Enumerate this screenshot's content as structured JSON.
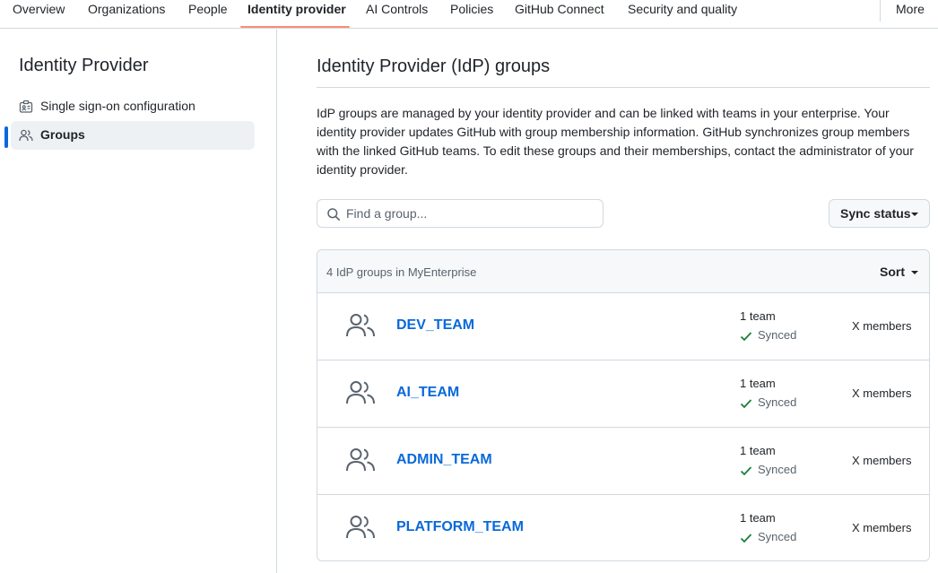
{
  "nav": {
    "tabs": [
      "Overview",
      "Organizations",
      "People",
      "Identity provider",
      "AI Controls",
      "Policies",
      "GitHub Connect",
      "Security and quality"
    ],
    "active_tab": "Identity provider",
    "more_label": "More"
  },
  "sidebar": {
    "title": "Identity Provider",
    "items": [
      {
        "label": "Single sign-on configuration",
        "icon": "id-badge-icon"
      },
      {
        "label": "Groups",
        "icon": "people-icon"
      }
    ],
    "selected": "Groups"
  },
  "main": {
    "title": "Identity Provider (IdP) groups",
    "description": "IdP groups are managed by your identity provider and can be linked with teams in your enterprise. Your identity provider updates GitHub with group membership information. GitHub synchronizes group members with the linked GitHub teams. To edit these groups and their memberships, contact the administrator of your identity provider.",
    "search": {
      "placeholder": "Find a group...",
      "value": ""
    },
    "sync_status_label": "Sync status",
    "list": {
      "count_label": "4 IdP groups in MyEnterprise",
      "sort_label": "Sort",
      "groups": [
        {
          "name": "DEV_TEAM",
          "teams": "1 team",
          "status": "Synced",
          "members": "X members"
        },
        {
          "name": "AI_TEAM",
          "teams": "1 team",
          "status": "Synced",
          "members": "X members"
        },
        {
          "name": "ADMIN_TEAM",
          "teams": "1 team",
          "status": "Synced",
          "members": "X members"
        },
        {
          "name": "PLATFORM_TEAM",
          "teams": "1 team",
          "status": "Synced",
          "members": "X members"
        }
      ]
    }
  },
  "colors": {
    "accent": "#0969da",
    "tab_underline": "#fd8c73",
    "success": "#1a7f37",
    "border": "#d1d9e0",
    "muted_text": "#59636e"
  }
}
